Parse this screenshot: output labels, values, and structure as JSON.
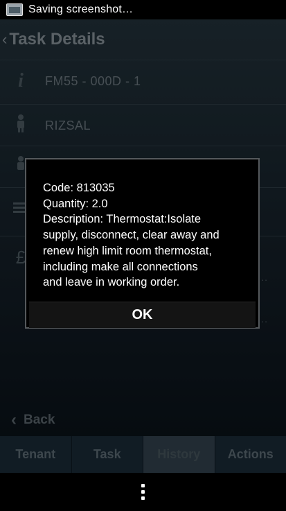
{
  "status_bar": {
    "text": "Saving screenshot…",
    "icon": "screenshot-icon"
  },
  "header": {
    "title": "Task Details",
    "back_icon": "chevron-left-icon"
  },
  "details": [
    {
      "icon": "info-icon",
      "value": "FM55 - 000D - 1"
    },
    {
      "icon": "person-icon",
      "value": "RIZSAL"
    },
    {
      "icon": "person-icon",
      "value": ""
    },
    {
      "icon": "list-icon",
      "value": ""
    },
    {
      "icon": "pound-icon",
      "value": ""
    }
  ],
  "back_label": "Back",
  "tabs": [
    {
      "label": "Tenant",
      "active": false
    },
    {
      "label": "Task",
      "active": false
    },
    {
      "label": "History",
      "active": true
    },
    {
      "label": "Actions",
      "active": false
    }
  ],
  "dialog": {
    "lines": [
      "Code: 813035",
      "Quantity: 2.0",
      "Description: Thermostat:Isolate",
      "supply, disconnect, clear away and",
      "renew high limit room thermostat,",
      "including make all connections",
      "and leave in working order."
    ],
    "ok_label": "OK"
  },
  "row_dots": [
    "...",
    "..."
  ]
}
